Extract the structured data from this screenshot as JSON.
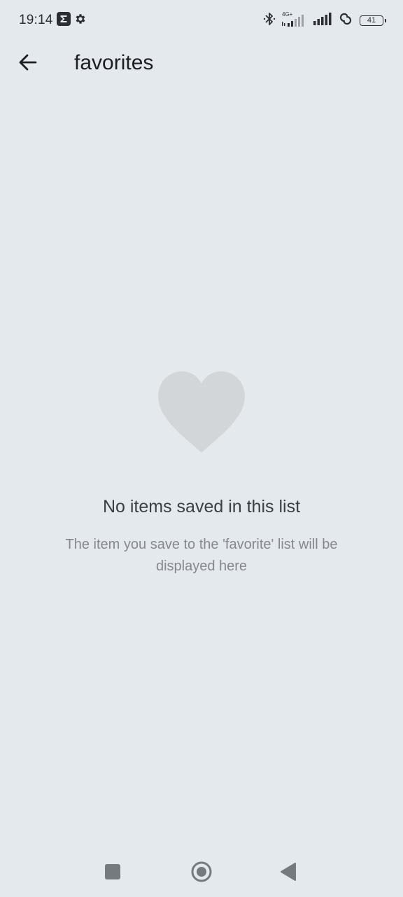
{
  "status_bar": {
    "time": "19:14",
    "network_label": "4G+",
    "battery_level": "41",
    "icons": [
      "sigma-app-icon",
      "settings-gear-icon",
      "bluetooth-icon",
      "signal-4g-icon",
      "signal-icon",
      "link-icon",
      "battery-icon"
    ]
  },
  "header": {
    "title": "favorites",
    "back_icon": "arrow-left-icon"
  },
  "empty_state": {
    "icon": "heart-icon",
    "title": "No items saved in this list",
    "description": "The item you save to the 'favorite' list will be displayed here"
  },
  "nav_bar": {
    "icons": [
      "recents-square-icon",
      "home-circle-icon",
      "back-triangle-icon"
    ]
  },
  "colors": {
    "background": "#e4e9ee",
    "heart": "#d3d6d9",
    "title_text": "#3a3f44",
    "muted_text": "#85898d",
    "icon_dark": "#2b2f33",
    "nav_icon": "#757a7f"
  }
}
